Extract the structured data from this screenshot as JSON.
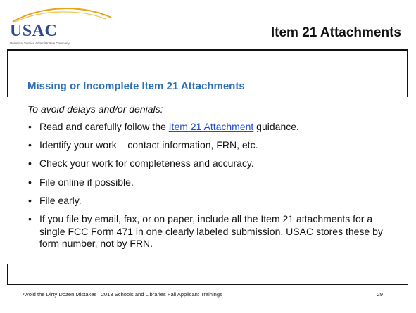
{
  "header": {
    "logo_text": "USAC",
    "logo_subtitle": "Universal Service Administrative Company",
    "title": "Item 21 Attachments"
  },
  "content": {
    "subheading": "Missing or Incomplete Item 21 Attachments",
    "lead": "To avoid delays and/or denials:",
    "bullets": [
      {
        "before": "Read and carefully follow the ",
        "link": "Item 21 Attachment",
        "after": " guidance."
      },
      {
        "text": "Identify your work – contact information, FRN, etc."
      },
      {
        "text": "Check your work for completeness and accuracy."
      },
      {
        "text": "File online if possible."
      },
      {
        "text": "File early."
      },
      {
        "text": "If you file by email, fax, or on paper, include all the Item 21 attachments for a single FCC Form 471 in one clearly labeled submission. USAC stores these by form number, not by FRN."
      }
    ],
    "bullet_glyph": "•"
  },
  "footer": {
    "text": "Avoid the Dirty Dozen Mistakes  I  2013 Schools and Libraries Fall Applicant Trainings",
    "page_number": "29"
  },
  "colors": {
    "logo": "#2f4b8f",
    "subheading": "#2e6fb4",
    "link": "#1f4fcf"
  }
}
